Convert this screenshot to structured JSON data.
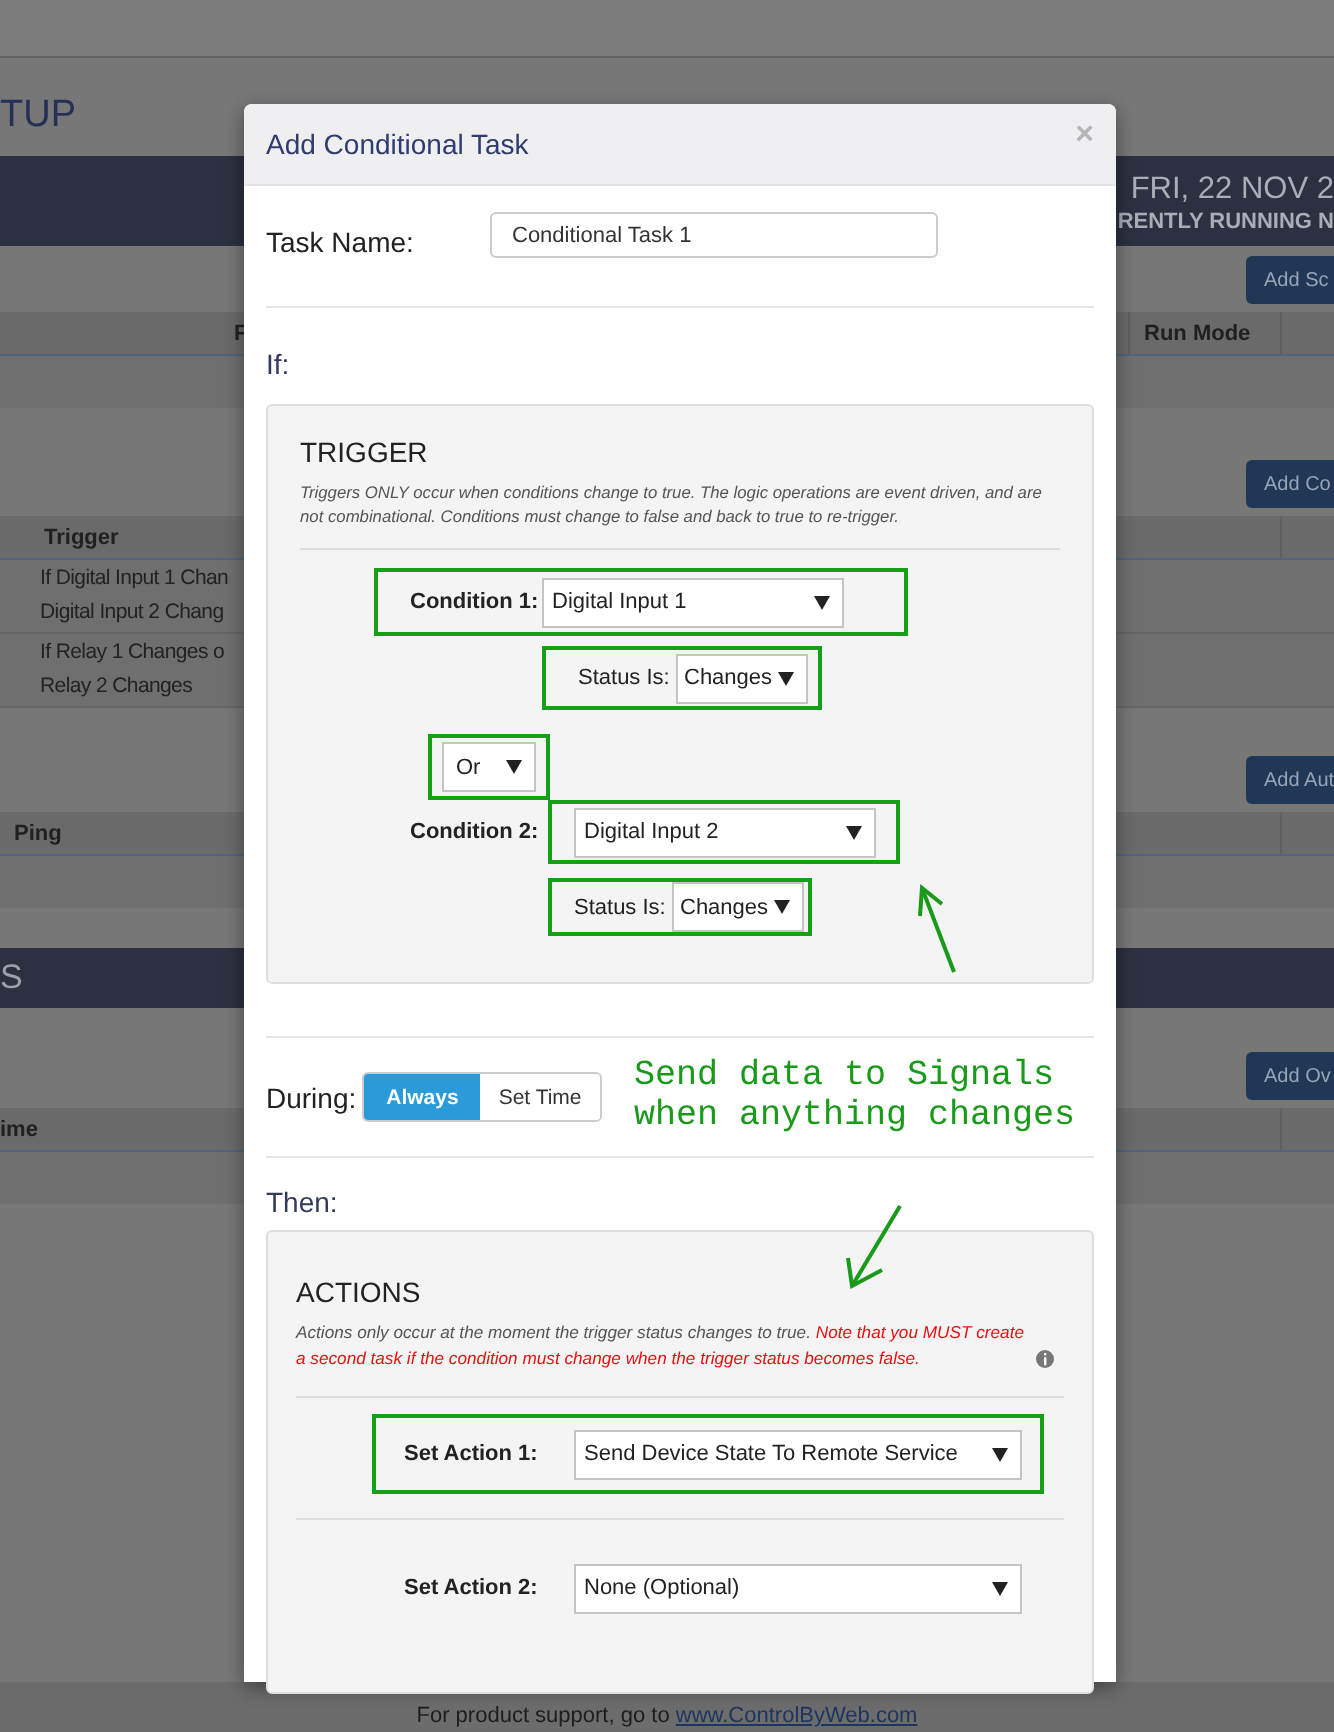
{
  "background": {
    "sections": [
      {
        "title": "TUP",
        "banner": {
          "date": "FRI, 22 NOV 2",
          "status": "RENTLY RUNNING N"
        },
        "tables": [
          {
            "button": "Add Sc",
            "columns": [
              "F",
              "Run Mode"
            ]
          },
          {
            "button": "Add Co",
            "columns": [
              "Trigger"
            ],
            "rows": [
              [
                "If Digital Input 1 Chan",
                "Digital Input 2 Chang"
              ],
              [
                "If Relay 1 Changes o",
                "Relay 2 Changes"
              ]
            ]
          },
          {
            "button": "Add Aut",
            "columns": [
              "Ping"
            ]
          }
        ]
      },
      {
        "title": "S",
        "tables": [
          {
            "button": "Add Ov",
            "columns": [
              "ime"
            ]
          }
        ]
      }
    ],
    "footer": {
      "text": "For product support, go to",
      "link": "www.ControlByWeb.com"
    }
  },
  "dialog": {
    "title": "Add Conditional Task",
    "close": "×",
    "task_name": {
      "label": "Task Name:",
      "value": "Conditional Task 1"
    },
    "if_label": "If:",
    "trigger": {
      "title": "TRIGGER",
      "note": "Triggers ONLY occur when conditions change to true. The logic operations are event driven, and are not combinational. Conditions must change to false and back to true to re-trigger.",
      "conditions": [
        {
          "label": "Condition 1:",
          "value": "Digital Input 1",
          "status_label": "Status Is:",
          "status": "Changes"
        },
        {
          "label": "Condition 2:",
          "value": "Digital Input 2",
          "status_label": "Status Is:",
          "status": "Changes"
        }
      ],
      "operator": "Or"
    },
    "during": {
      "label": "During:",
      "options": [
        {
          "label": "Always",
          "selected": true
        },
        {
          "label": "Set Time",
          "selected": false
        }
      ]
    },
    "then_label": "Then:",
    "actions": {
      "title": "ACTIONS",
      "note": "Actions only occur at the moment the trigger status changes to true.",
      "warning": "Note that you MUST create a second task if the condition must change when the trigger status becomes false.",
      "items": [
        {
          "label": "Set Action 1:",
          "value": "Send Device State To Remote Service",
          "highlighted": true
        },
        {
          "label": "Set Action 2:",
          "value": "None (Optional)",
          "highlighted": false
        }
      ]
    }
  },
  "annotation": {
    "text": "Send data to Signals\nwhen anything changes"
  }
}
